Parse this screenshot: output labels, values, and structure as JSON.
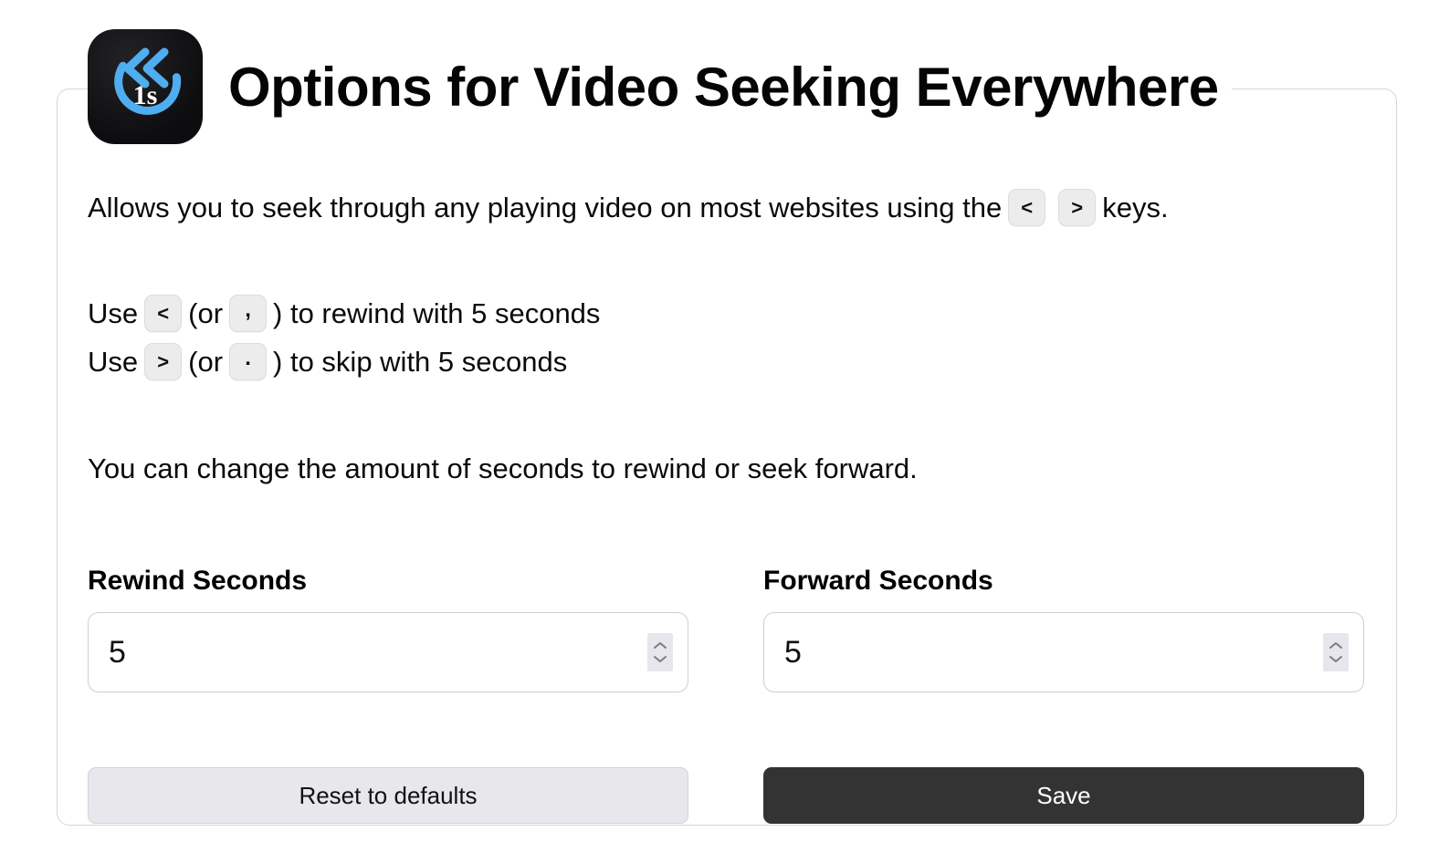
{
  "window": {
    "title": "Options for Video Seeking Everywhere",
    "background_color": "#ffffff"
  },
  "header": {
    "title": "Options for Video Seeking Everywhere",
    "icon": {
      "name": "rewind-1s-app-icon",
      "badge_text": "1s",
      "accent_color": "#4FAEEF",
      "background_color": "#111113"
    }
  },
  "intro": {
    "text_before": "Allows you to seek through any playing video on most websites using the",
    "key_left": "<",
    "key_right": ">",
    "text_after": "keys."
  },
  "usage": [
    {
      "prefix": "Use",
      "key_primary": "<",
      "mid": "(or",
      "key_alt": ",",
      "suffix": ") to rewind with 5 seconds"
    },
    {
      "prefix": "Use",
      "key_primary": ">",
      "mid": "(or",
      "key_alt": ".",
      "suffix": ") to skip with 5 seconds"
    }
  ],
  "note": {
    "text": "You can change the amount of seconds to rewind or seek forward."
  },
  "fields": {
    "rewind": {
      "label": "Rewind Seconds",
      "value": "5",
      "spinner_up_icon": "chevron-up-icon",
      "spinner_down_icon": "chevron-down-icon"
    },
    "forward": {
      "label": "Forward Seconds",
      "value": "5",
      "spinner_up_icon": "chevron-up-icon",
      "spinner_down_icon": "chevron-down-icon"
    }
  },
  "actions": {
    "reset_label": "Reset to defaults",
    "save_label": "Save",
    "save_color": "#333333",
    "reset_color": "#e7e7ec"
  }
}
